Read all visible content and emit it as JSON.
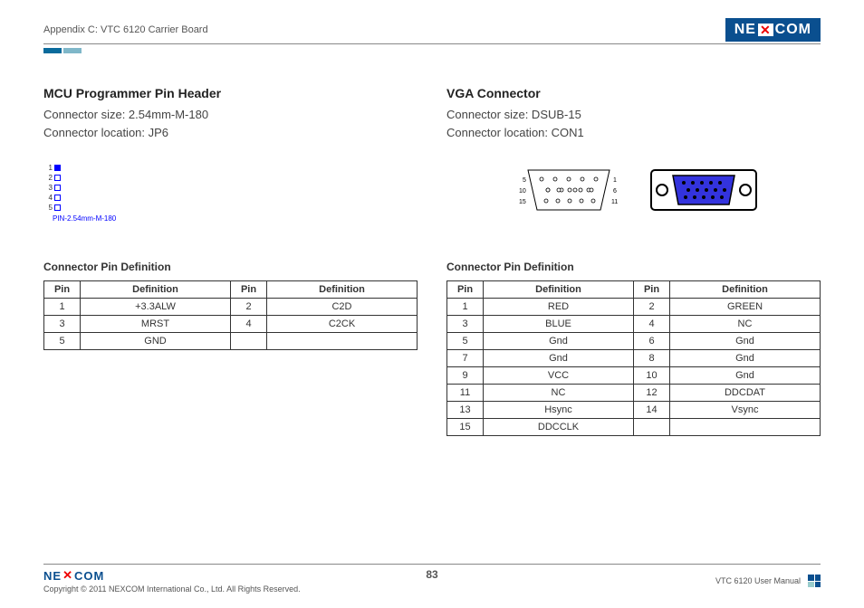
{
  "header": {
    "breadcrumb": "Appendix C: VTC 6120 Carrier Board",
    "logo": "NEXCOM"
  },
  "left": {
    "title": "MCU Programmer Pin Header",
    "size_label": "Connector size: 2.54mm-M-180",
    "loc_label": "Connector location: JP6",
    "diagram_caption": "PIN-2.54mm-M-180",
    "pins_numbers": [
      "1",
      "2",
      "3",
      "4",
      "5"
    ],
    "table_title": "Connector Pin Definition",
    "headers": {
      "pin": "Pin",
      "def": "Definition"
    },
    "rows": [
      {
        "p1": "1",
        "d1": "+3.3ALW",
        "p2": "2",
        "d2": "C2D"
      },
      {
        "p1": "3",
        "d1": "MRST",
        "p2": "4",
        "d2": "C2CK"
      },
      {
        "p1": "5",
        "d1": "GND",
        "p2": "",
        "d2": ""
      }
    ]
  },
  "right": {
    "title": "VGA Connector",
    "size_label": "Connector size: DSUB-15",
    "loc_label": "Connector location: CON1",
    "row_labels": {
      "r1l": "5",
      "r1r": "1",
      "r2l": "10",
      "r2r": "6",
      "r3l": "15",
      "r3r": "11"
    },
    "table_title": "Connector Pin Definition",
    "headers": {
      "pin": "Pin",
      "def": "Definition"
    },
    "rows": [
      {
        "p1": "1",
        "d1": "RED",
        "p2": "2",
        "d2": "GREEN"
      },
      {
        "p1": "3",
        "d1": "BLUE",
        "p2": "4",
        "d2": "NC"
      },
      {
        "p1": "5",
        "d1": "Gnd",
        "p2": "6",
        "d2": "Gnd"
      },
      {
        "p1": "7",
        "d1": "Gnd",
        "p2": "8",
        "d2": "Gnd"
      },
      {
        "p1": "9",
        "d1": "VCC",
        "p2": "10",
        "d2": "Gnd"
      },
      {
        "p1": "11",
        "d1": "NC",
        "p2": "12",
        "d2": "DDCDAT"
      },
      {
        "p1": "13",
        "d1": "Hsync",
        "p2": "14",
        "d2": "Vsync"
      },
      {
        "p1": "15",
        "d1": "DDCCLK",
        "p2": "",
        "d2": ""
      }
    ]
  },
  "footer": {
    "copyright": "Copyright © 2011 NEXCOM International Co., Ltd. All Rights Reserved.",
    "page": "83",
    "manual": "VTC 6120 User Manual",
    "logo": "NEXCOM"
  }
}
